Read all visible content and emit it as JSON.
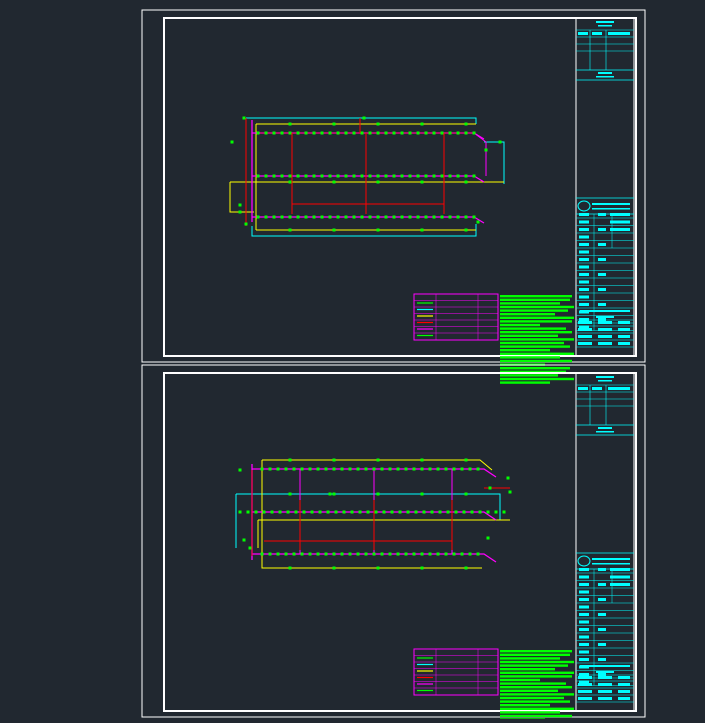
{
  "app": {
    "view": "cad-model-space",
    "background_color": "#212830"
  },
  "colors": {
    "frame": "#ffffff",
    "cyan": "#00ffff",
    "yellow": "#ffff00",
    "magenta": "#ff00ff",
    "red": "#ff0000",
    "green": "#00ff00"
  },
  "sheets": [
    {
      "id": "sheet-1",
      "label": ""
    },
    {
      "id": "sheet-2",
      "label": ""
    }
  ]
}
